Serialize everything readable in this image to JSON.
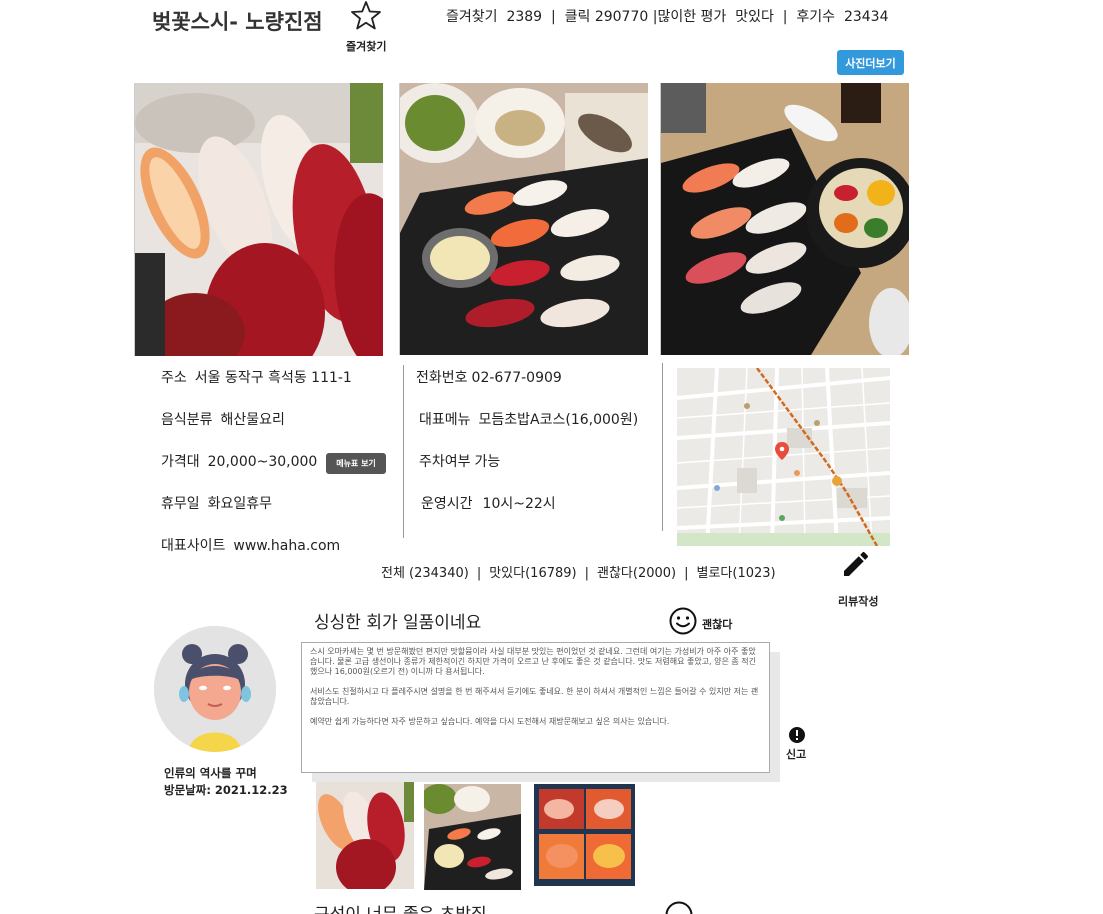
{
  "header": {
    "title": "벚꽃스시- 노량진점",
    "favorite_label": "즐겨찾기",
    "stats": {
      "favorites_label": "즐겨찾기",
      "favorites": "2389",
      "clicks_label": "클릭",
      "clicks": "290770",
      "top_rating_label": "많이한 평가",
      "top_rating": "맛있다",
      "reviews_label": "후기수",
      "reviews": "23434",
      "sep": "|"
    },
    "photo_more_label": "사진더보기"
  },
  "info": {
    "address_label": "주소",
    "address": "서울 동작구 흑석동 111-1",
    "category_label": "음식분류",
    "category": "해산물요리",
    "price_label": "가격대",
    "price": "20,000~30,000",
    "menu_button_label": "메뉴표 보기",
    "holiday_label": "휴무일",
    "holiday": "화요일휴무",
    "site_label": "대표사이트",
    "site": "www.haha.com",
    "phone_label": "전화번호",
    "phone": "02-677-0909",
    "main_menu_label": "대표메뉴",
    "main_menu": "모듬초밥A코스(16,000원)",
    "parking_label": "주차여부",
    "parking": "가능",
    "hours_label": "운영시간",
    "hours": "10시~22시"
  },
  "reviews_filter": {
    "all": "전체 (234340)",
    "good": "맛있다(16789)",
    "ok": "괜찮다(2000)",
    "bad": "별로다(1023)",
    "sep": "|"
  },
  "write_review_label": "리뷰작성",
  "review": {
    "title": "싱싱한 회가 일품이네요",
    "rating": "괜찮다",
    "user": "인류의 역사를 꾸며",
    "visit_date": "방문날짜: 2021.12.23",
    "report_label": "신고",
    "body": [
      "스시 오마카세는 몇 번 방문해봤던 편지만 맛할뮴이라 사실 대부분 맛있는 편이었던 것 같네요. 그런데 여기는 가성비가 아주 아주 좋았습니다. 물론 고급 생선이나 종류가 제한적이긴 하지만 가격이 오르고 난 후에도 좋은 것 같습니다. 맛도 저렴해요 좋았고, 양은 좀 적긴 했으나 16,000원(오르기 전) 이니까 다 용서됩니다.",
      "서비스도 친절하시고 다 플레주시면 설명을 한 번 해주셔서 듣기에도 좋네요. 한 분이 하셔서 개별적인 느낌은 들어갈 수 있지만 저는 괜찮았습니다.",
      "예약만 쉽게 가능하다면 자주 방문하고 싶습니다. 예약을 다시 도전해서 재방문해보고 싶은 의사는 있습니다."
    ]
  },
  "next_review": {
    "title": "구성이 너무 좋은 초밥집"
  },
  "icons": {
    "star": "star-outline-icon",
    "pencil": "pencil-icon",
    "smile": "smile-icon",
    "alert": "alert-circle-icon",
    "map_pin": "map-pin-icon"
  },
  "colors": {
    "accent_button": "#3399dd",
    "menu_button": "#555555",
    "map_route": "#d2691e",
    "map_pin": "#e84c3d"
  }
}
